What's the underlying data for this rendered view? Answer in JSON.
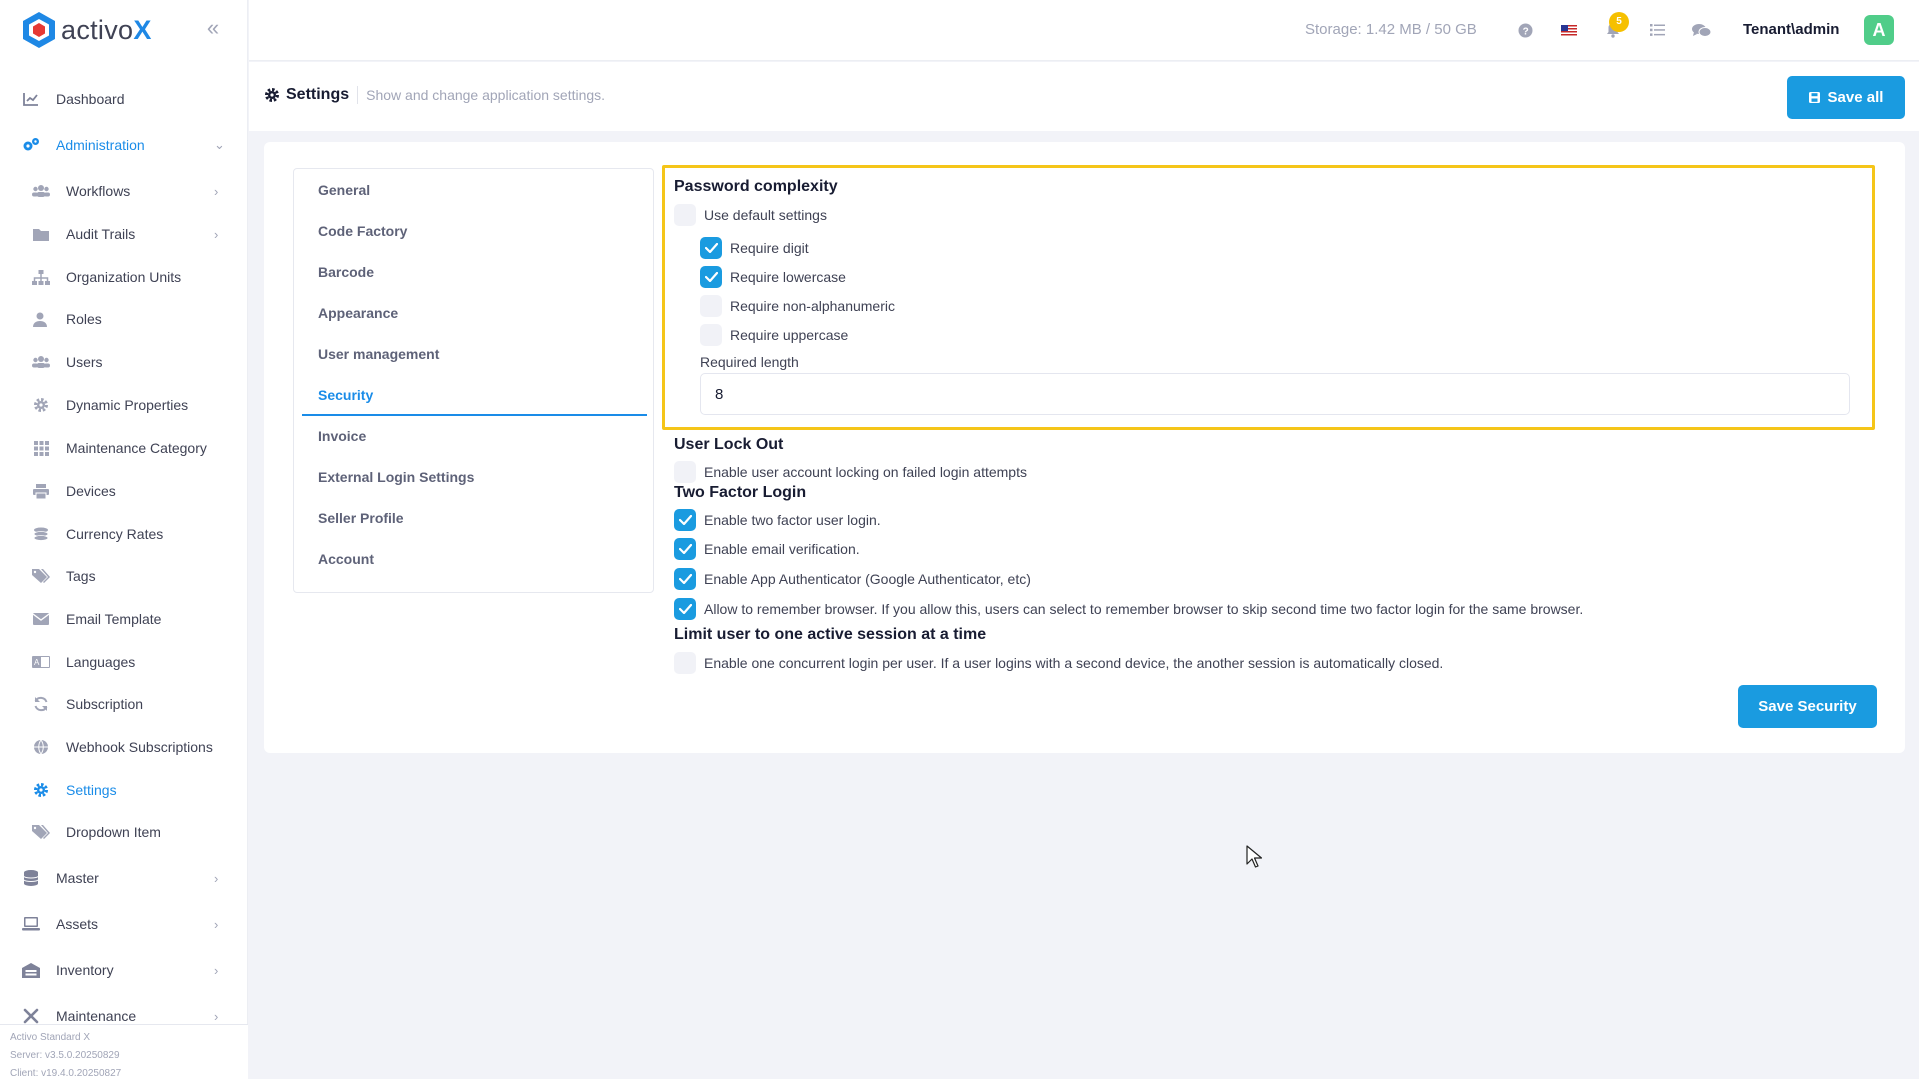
{
  "brand": {
    "name_prefix": "activo",
    "name_suffix": "X"
  },
  "sidebar": {
    "items": [
      {
        "label": "Dashboard",
        "icon": "chart-line-icon"
      },
      {
        "label": "Administration",
        "icon": "cogs-icon",
        "active": true
      },
      {
        "label": "Workflows",
        "icon": "users-icon"
      },
      {
        "label": "Audit Trails",
        "icon": "folder-icon"
      },
      {
        "label": "Organization Units",
        "icon": "sitemap-icon"
      },
      {
        "label": "Roles",
        "icon": "user-role-icon"
      },
      {
        "label": "Users",
        "icon": "users-icon"
      },
      {
        "label": "Dynamic Properties",
        "icon": "cog-icon"
      },
      {
        "label": "Maintenance Category",
        "icon": "grid-icon"
      },
      {
        "label": "Devices",
        "icon": "printer-icon"
      },
      {
        "label": "Currency Rates",
        "icon": "coins-icon"
      },
      {
        "label": "Tags",
        "icon": "tags-icon"
      },
      {
        "label": "Email Template",
        "icon": "envelope-icon"
      },
      {
        "label": "Languages",
        "icon": "language-icon"
      },
      {
        "label": "Subscription",
        "icon": "refresh-icon"
      },
      {
        "label": "Webhook Subscriptions",
        "icon": "globe-icon"
      },
      {
        "label": "Settings",
        "icon": "cog-icon",
        "active": true
      },
      {
        "label": "Dropdown Item",
        "icon": "tags-icon"
      },
      {
        "label": "Master",
        "icon": "database-icon"
      },
      {
        "label": "Assets",
        "icon": "laptop-icon"
      },
      {
        "label": "Inventory",
        "icon": "warehouse-icon"
      },
      {
        "label": "Maintenance",
        "icon": "tools-icon"
      }
    ],
    "footer": {
      "product": "Activo Standard X",
      "server": "Server: v3.5.0.20250829",
      "client": "Client: v19.4.0.20250827"
    }
  },
  "header": {
    "storage": "Storage: 1.42 MB / 50 GB",
    "notification_count": "5",
    "tenant": "Tenant\\admin",
    "avatar_letter": "A"
  },
  "toolbar": {
    "title": "Settings",
    "description": "Show and change application settings.",
    "save_all_label": "Save all"
  },
  "settings_tabs": [
    "General",
    "Code Factory",
    "Barcode",
    "Appearance",
    "User management",
    "Security",
    "Invoice",
    "External Login Settings",
    "Seller Profile",
    "Account"
  ],
  "active_tab": "Security",
  "security": {
    "password_complexity": {
      "title": "Password complexity",
      "use_default": {
        "label": "Use default settings",
        "checked": false
      },
      "require_digit": {
        "label": "Require digit",
        "checked": true
      },
      "require_lowercase": {
        "label": "Require lowercase",
        "checked": true
      },
      "require_non_alphanumeric": {
        "label": "Require non-alphanumeric",
        "checked": false
      },
      "require_uppercase": {
        "label": "Require uppercase",
        "checked": false
      },
      "required_length_label": "Required length",
      "required_length_value": "8"
    },
    "user_lock_out": {
      "title": "User Lock Out",
      "enable_locking": {
        "label": "Enable user account locking on failed login attempts",
        "checked": false
      }
    },
    "two_factor": {
      "title": "Two Factor Login",
      "enable_two_factor": {
        "label": "Enable two factor user login.",
        "checked": true
      },
      "enable_email": {
        "label": "Enable email verification.",
        "checked": true
      },
      "enable_authenticator": {
        "label": "Enable App Authenticator (Google Authenticator, etc)",
        "checked": true
      },
      "remember_browser": {
        "label": "Allow to remember browser. If you allow this, users can select to remember browser to skip second time two factor login for the same browser.",
        "checked": true
      }
    },
    "single_session": {
      "title": "Limit user to one active session at a time",
      "enable_one_session": {
        "label": "Enable one concurrent login per user. If a user logins with a second device, the another session is automatically closed.",
        "checked": false
      }
    },
    "save_label": "Save Security"
  },
  "colors": {
    "accent": "#1a9be0",
    "highlight": "#f5c518",
    "badge": "#f6c000",
    "avatar": "#50cd89"
  }
}
